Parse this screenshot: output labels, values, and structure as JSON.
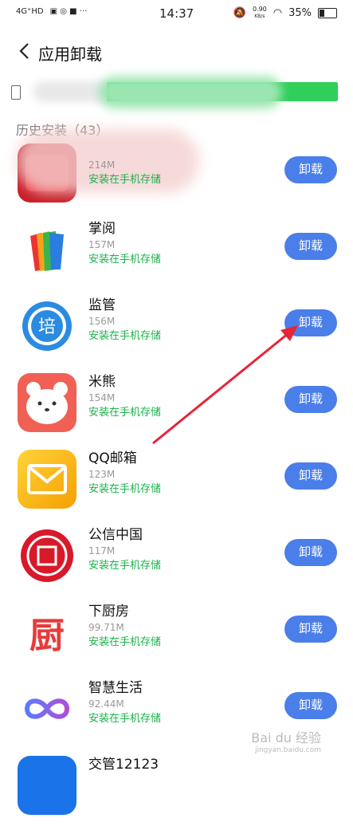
{
  "status_bar": {
    "network": "4G⁺HD",
    "time": "14:37",
    "speed_value": "0.90",
    "speed_unit": "KB/s",
    "battery": "35%"
  },
  "header": {
    "title": "应用卸载"
  },
  "section_title": "历史安装（43）",
  "apps": [
    {
      "name": "",
      "size": "214M",
      "location": "安装在手机存储",
      "button": "卸载",
      "color": "#d0202a"
    },
    {
      "name": "掌阅",
      "size": "157M",
      "location": "安装在手机存储",
      "button": "卸载",
      "color": "#f2f2f2"
    },
    {
      "name": "监管",
      "size": "156M",
      "location": "安装在手机存储",
      "button": "卸载",
      "color": "#2b8be0"
    },
    {
      "name": "米熊",
      "size": "154M",
      "location": "安装在手机存储",
      "button": "卸载",
      "color": "#f06055"
    },
    {
      "name": "QQ邮箱",
      "size": "123M",
      "location": "安装在手机存储",
      "button": "卸载",
      "color": "#f8c21c"
    },
    {
      "name": "公信中国",
      "size": "117M",
      "location": "安装在手机存储",
      "button": "卸载",
      "color": "#d8192a"
    },
    {
      "name": "下厨房",
      "size": "99.71M",
      "location": "安装在手机存储",
      "button": "卸载",
      "color": "#e83a3a"
    },
    {
      "name": "智慧生活",
      "size": "92.44M",
      "location": "安装在手机存储",
      "button": "卸载",
      "color": "#6c5ce7"
    },
    {
      "name": "交管12123",
      "size": "",
      "location": "",
      "button": "",
      "color": "#1a73e8"
    }
  ],
  "watermark": {
    "text": "Bai du 经验",
    "sub": "jingyan.baidu.com"
  }
}
